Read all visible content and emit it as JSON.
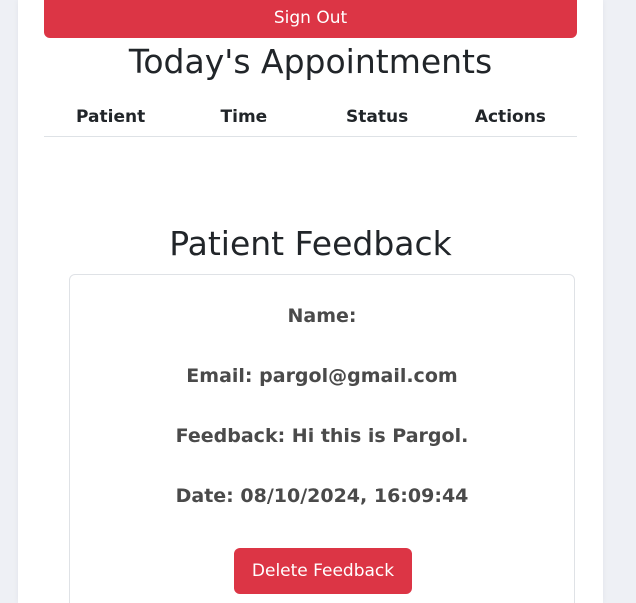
{
  "header": {
    "sign_out_label": "Sign Out"
  },
  "appointments": {
    "title": "Today's Appointments",
    "columns": [
      "Patient",
      "Time",
      "Status",
      "Actions"
    ]
  },
  "feedback": {
    "title": "Patient Feedback",
    "name_label": "Name:",
    "name_value": "",
    "email_label": "Email:",
    "email_value": "pargol@gmail.com",
    "feedback_label": "Feedback:",
    "feedback_value": "Hi this is Pargol.",
    "date_label": "Date:",
    "date_value": "08/10/2024, 16:09:44",
    "delete_label": "Delete Feedback"
  },
  "colors": {
    "danger": "#dc3545",
    "background": "#eef0f5",
    "card": "#ffffff"
  }
}
